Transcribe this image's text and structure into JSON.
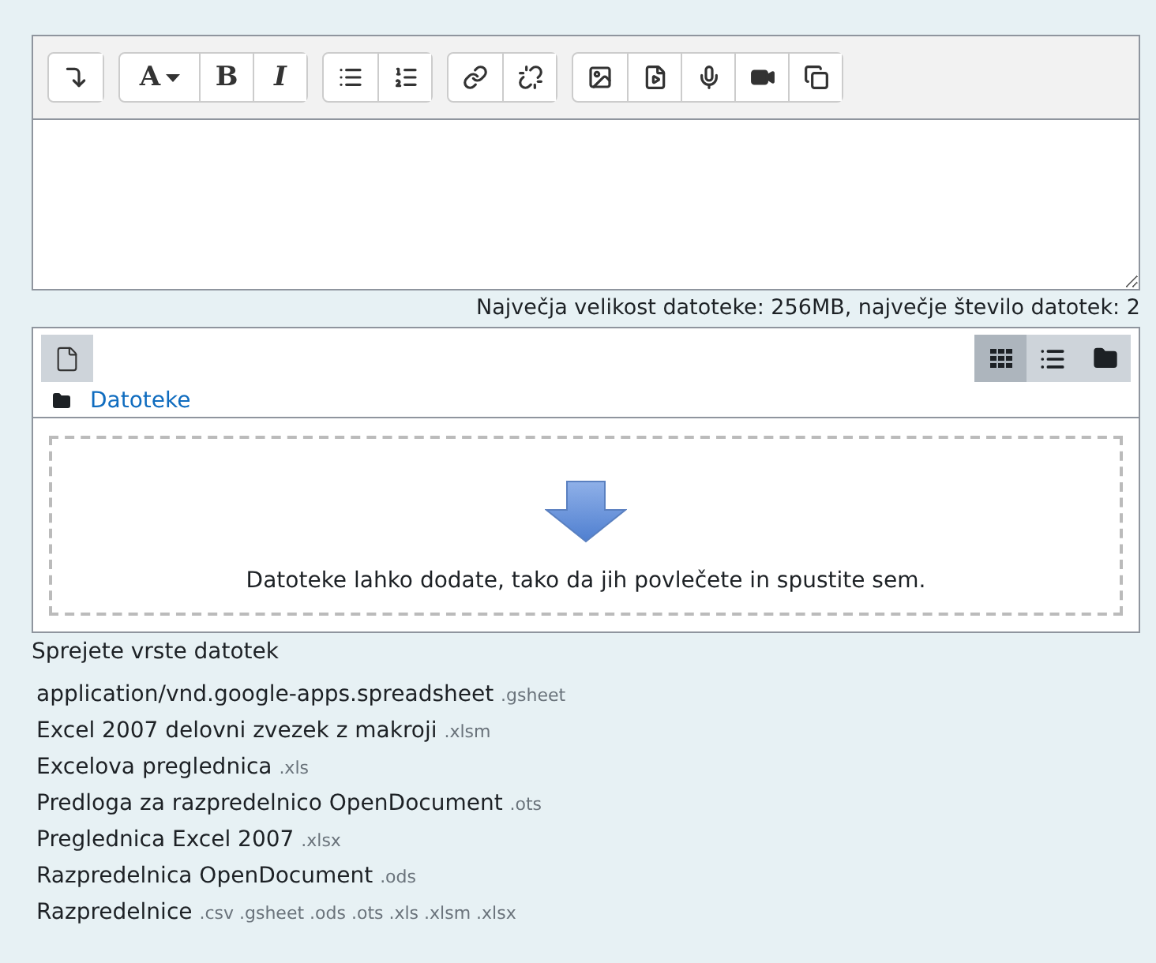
{
  "editor_toolbar": {
    "groups": [
      [
        {
          "kind": "collapse"
        }
      ],
      [
        {
          "kind": "font",
          "label": "A"
        },
        {
          "kind": "bold",
          "label": "B"
        },
        {
          "kind": "italic",
          "label": "I"
        }
      ],
      [
        {
          "kind": "bullets"
        },
        {
          "kind": "numbers"
        }
      ],
      [
        {
          "kind": "link"
        },
        {
          "kind": "unlink"
        }
      ],
      [
        {
          "kind": "image"
        },
        {
          "kind": "media"
        },
        {
          "kind": "record-audio"
        },
        {
          "kind": "record-video"
        },
        {
          "kind": "paste"
        }
      ]
    ]
  },
  "limits": "Največja velikost datoteke: 256MB, največje število datotek: 2",
  "file_manager": {
    "views": [
      {
        "kind": "icons",
        "selected": true
      },
      {
        "kind": "list",
        "selected": false
      },
      {
        "kind": "tree",
        "selected": false
      }
    ],
    "path": "Datoteke",
    "drop_hint": "Datoteke lahko dodate, tako da jih povlečete in spustite sem."
  },
  "accepted_title": "Sprejete vrste datotek",
  "accepted_types": [
    {
      "name": "application/vnd.google-apps.spreadsheet",
      "ext": ".gsheet"
    },
    {
      "name": "Excel 2007 delovni zvezek z makroji",
      "ext": ".xlsm"
    },
    {
      "name": "Excelova preglednica",
      "ext": ".xls"
    },
    {
      "name": "Predloga za razpredelnico OpenDocument",
      "ext": ".ots"
    },
    {
      "name": "Preglednica Excel 2007",
      "ext": ".xlsx"
    },
    {
      "name": "Razpredelnica OpenDocument",
      "ext": ".ods"
    },
    {
      "name": "Razpredelnice",
      "ext": ".csv .gsheet .ods .ots .xls .xlsm .xlsx"
    }
  ]
}
